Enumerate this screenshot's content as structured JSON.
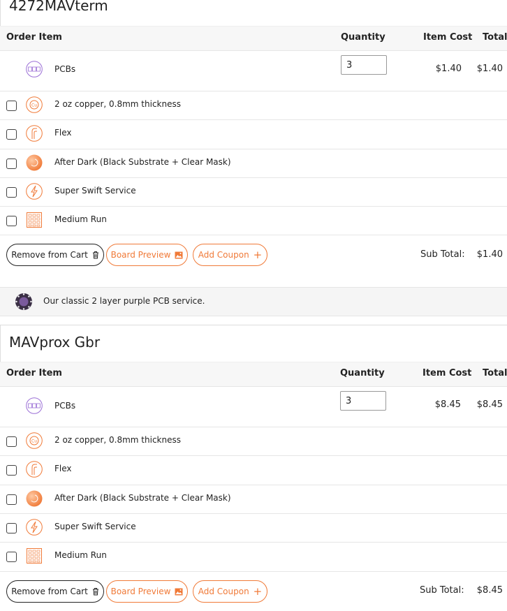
{
  "colors": {
    "accent": "#f07a38",
    "purple": "#9b6fd6",
    "row_border": "#e6e6e6"
  },
  "header": {
    "order_item": "Order Item",
    "quantity": "Quantity",
    "item_cost": "Item Cost",
    "total": "Total"
  },
  "orders": [
    {
      "title": "4272MAVterm",
      "pcb": {
        "label": "PCBs",
        "quantity": "3",
        "item_cost": "$1.40",
        "total": "$1.40"
      },
      "options": [
        {
          "label": "2 oz copper, 0.8mm thickness",
          "icon": "copper-icon"
        },
        {
          "label": "Flex",
          "icon": "flex-icon"
        },
        {
          "label": "After Dark (Black Substrate + Clear Mask)",
          "icon": "after-dark-icon"
        },
        {
          "label": "Super Swift Service",
          "icon": "lightning-icon"
        },
        {
          "label": "Medium Run",
          "icon": "medium-run-icon"
        }
      ],
      "buttons": {
        "remove": "Remove from Cart",
        "preview": "Board Preview",
        "coupon": "Add Coupon"
      },
      "subtotal_label": "Sub Total:",
      "subtotal_value": "$1.40",
      "description": "Our classic 2 layer purple PCB service."
    },
    {
      "title": "MAVprox Gbr",
      "pcb": {
        "label": "PCBs",
        "quantity": "3",
        "item_cost": "$8.45",
        "total": "$8.45"
      },
      "options": [
        {
          "label": "2 oz copper, 0.8mm thickness",
          "icon": "copper-icon"
        },
        {
          "label": "Flex",
          "icon": "flex-icon"
        },
        {
          "label": "After Dark (Black Substrate + Clear Mask)",
          "icon": "after-dark-icon"
        },
        {
          "label": "Super Swift Service",
          "icon": "lightning-icon"
        },
        {
          "label": "Medium Run",
          "icon": "medium-run-icon"
        }
      ],
      "buttons": {
        "remove": "Remove from Cart",
        "preview": "Board Preview",
        "coupon": "Add Coupon"
      },
      "subtotal_label": "Sub Total:",
      "subtotal_value": "$8.45"
    }
  ]
}
